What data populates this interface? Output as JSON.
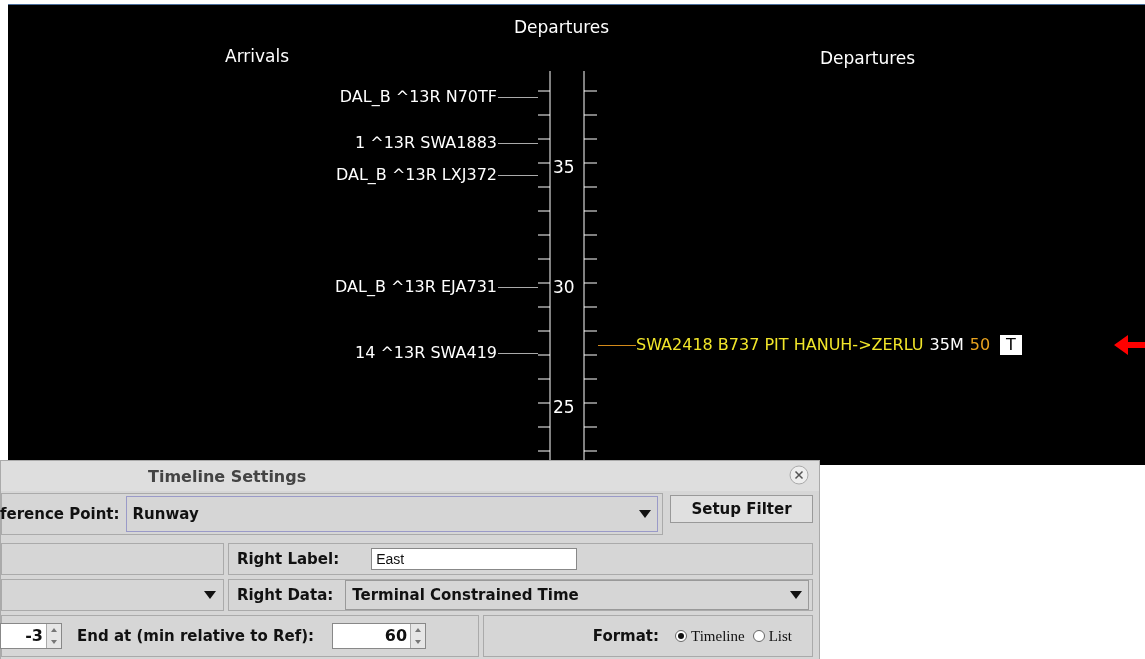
{
  "timeline": {
    "header": "Departures",
    "left_title": "Arrivals",
    "right_title": "Departures",
    "tick_labels": [
      "35",
      "30",
      "25"
    ],
    "arrivals": [
      {
        "text": "DAL_B ^13R N70TF"
      },
      {
        "text": "1 ^13R SWA1883"
      },
      {
        "text": "DAL_B ^13R LXJ372"
      },
      {
        "text": "DAL_B ^13R EJA731"
      },
      {
        "text": "14 ^13R SWA419"
      }
    ],
    "departures": [
      {
        "flight": "SWA2418 B737 PIT HANUH->ZERLU",
        "time": "35M",
        "speed": "50",
        "tag": "T",
        "pointed": true
      }
    ]
  },
  "dialog": {
    "title": "Timeline Settings",
    "reference_label": "ference Point:",
    "reference_value": "Runway",
    "filter_button": "Setup Filter",
    "right_label_label": "Right Label:",
    "right_label_value": "East",
    "right_data_label": "Right Data:",
    "right_data_value": "Terminal Constrained Time",
    "start_value": "-3",
    "end_label": "End at (min relative to Ref):",
    "end_value": "60",
    "format_label": "Format:",
    "formats": [
      {
        "label": "Timeline",
        "selected": true
      },
      {
        "label": "List",
        "selected": false
      }
    ]
  }
}
